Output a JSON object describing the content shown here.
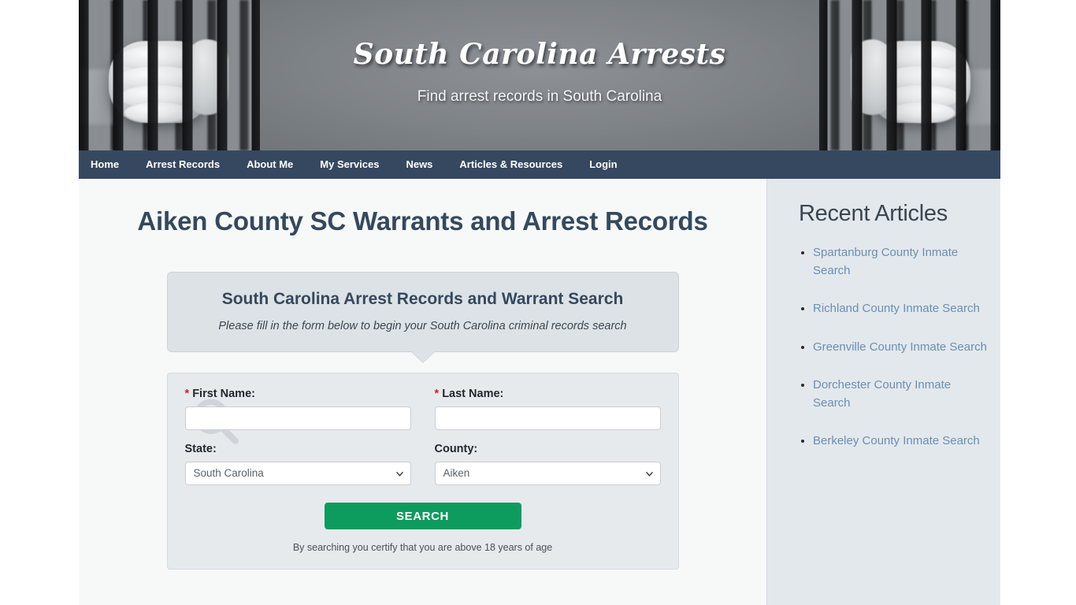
{
  "header": {
    "site_title": "South Carolina Arrests",
    "tagline": "Find arrest records in South Carolina",
    "banner_icon": "jail-bars-hands-photo"
  },
  "nav": {
    "items": [
      {
        "label": "Home"
      },
      {
        "label": "Arrest Records"
      },
      {
        "label": "About Me"
      },
      {
        "label": "My Services"
      },
      {
        "label": "News"
      },
      {
        "label": "Articles & Resources"
      },
      {
        "label": "Login"
      }
    ]
  },
  "main": {
    "page_title": "Aiken County SC Warrants and Arrest Records",
    "callout": {
      "title": "South Carolina Arrest Records and Warrant Search",
      "subtitle": "Please fill in the form below to begin your South Carolina criminal records search"
    },
    "form": {
      "first_name": {
        "label": "First Name:",
        "required_marker": "*",
        "value": "",
        "placeholder": ""
      },
      "last_name": {
        "label": "Last Name:",
        "required_marker": "*",
        "value": "",
        "placeholder": ""
      },
      "state": {
        "label": "State:",
        "value": "South Carolina",
        "options": [
          "South Carolina"
        ]
      },
      "county": {
        "label": "County:",
        "value": "Aiken",
        "options": [
          "Aiken"
        ]
      },
      "submit_label": "SEARCH",
      "disclaimer": "By searching you certify that you are above 18 years of age",
      "watermark_icon": "magnifier-icon"
    }
  },
  "sidebar": {
    "title": "Recent Articles",
    "links": [
      {
        "label": "Spartanburg County Inmate Search"
      },
      {
        "label": "Richland County Inmate Search"
      },
      {
        "label": "Greenville County Inmate Search"
      },
      {
        "label": "Dorchester County Inmate Search"
      },
      {
        "label": "Berkeley County Inmate Search"
      }
    ]
  },
  "colors": {
    "nav_bg": "#253853",
    "heading": "#34495e",
    "button_green": "#0e9b5e",
    "link_blue": "#6a8fb5",
    "sidebar_bg": "#e3e8ec",
    "main_bg": "#f7f9f9",
    "required_red": "#cc2222"
  }
}
